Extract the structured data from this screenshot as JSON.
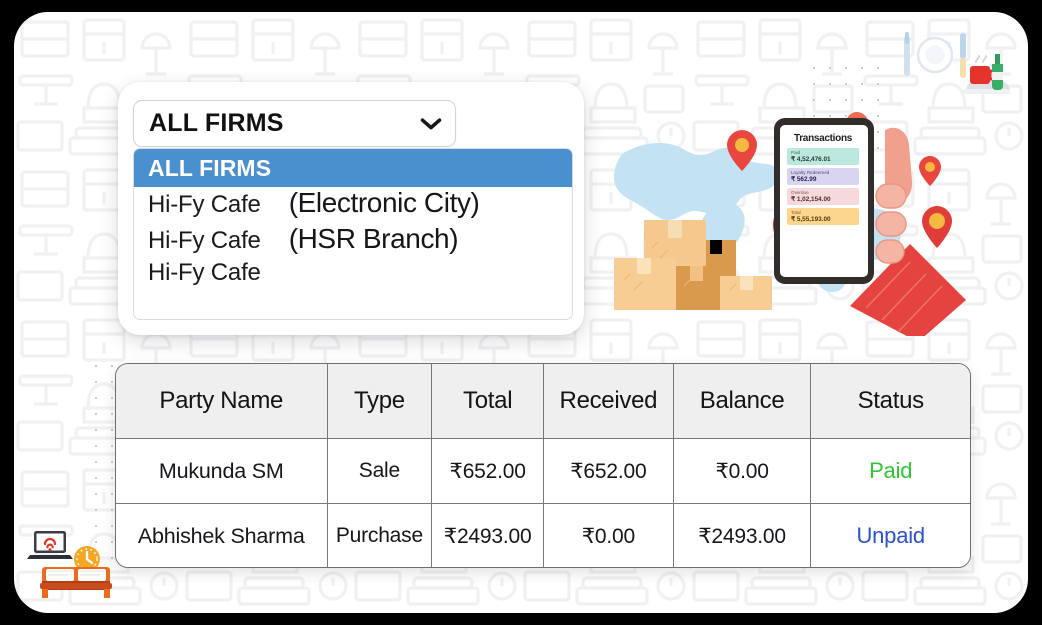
{
  "firm_selector": {
    "selected_value": "ALL FIRMS",
    "chevron_icon": "chevron-down-icon",
    "options": [
      {
        "name": "ALL FIRMS",
        "suffix": "",
        "selected": true
      },
      {
        "name": "Hi-Fy Cafe",
        "suffix": "(Electronic City)",
        "selected": false
      },
      {
        "name": "Hi-Fy Cafe",
        "suffix": "(HSR Branch)",
        "selected": false
      },
      {
        "name": "Hi-Fy Cafe",
        "suffix": "",
        "selected": false
      }
    ],
    "highlight_color": "#4a90cf"
  },
  "illustration": {
    "phone_card": {
      "title": "Transactions",
      "rows": [
        {
          "label": "Paid",
          "amount": "₹ 4,52,476.01",
          "color": "#bde8dd"
        },
        {
          "label": "Loyalty Redeemed",
          "amount": "₹ 562.99",
          "color": "#d9d4ef"
        },
        {
          "label": "Overdue",
          "amount": "₹ 1,02,154.00",
          "color": "#f6d9dc"
        },
        {
          "label": "Total",
          "amount": "₹ 5,55,193.00",
          "color": "#fbd68c"
        }
      ]
    },
    "icons": [
      "world-map-icon",
      "location-pin-icon",
      "cardboard-boxes-icon",
      "hand-holding-phone-icon",
      "fork-icon",
      "plate-icon",
      "knife-icon",
      "food-tray-icon",
      "coffee-cup-icon",
      "bottle-icon",
      "laptop-wifi-icon",
      "clock-icon",
      "bed-icon"
    ]
  },
  "table": {
    "columns": [
      "Party Name",
      "Type",
      "Total",
      "Received",
      "Balance",
      "Status"
    ],
    "rows": [
      {
        "party_name": "Mukunda SM",
        "type": "Sale",
        "total": "₹652.00",
        "received": "₹652.00",
        "balance": "₹0.00",
        "status": "Paid",
        "status_color": "#2ec832"
      },
      {
        "party_name": "Abhishek Sharma",
        "type": "Purchase",
        "total": "₹2493.00",
        "received": "₹0.00",
        "balance": "₹2493.00",
        "status": "Unpaid",
        "status_color": "#2b4fd0"
      }
    ],
    "header_background": "#efefef"
  }
}
